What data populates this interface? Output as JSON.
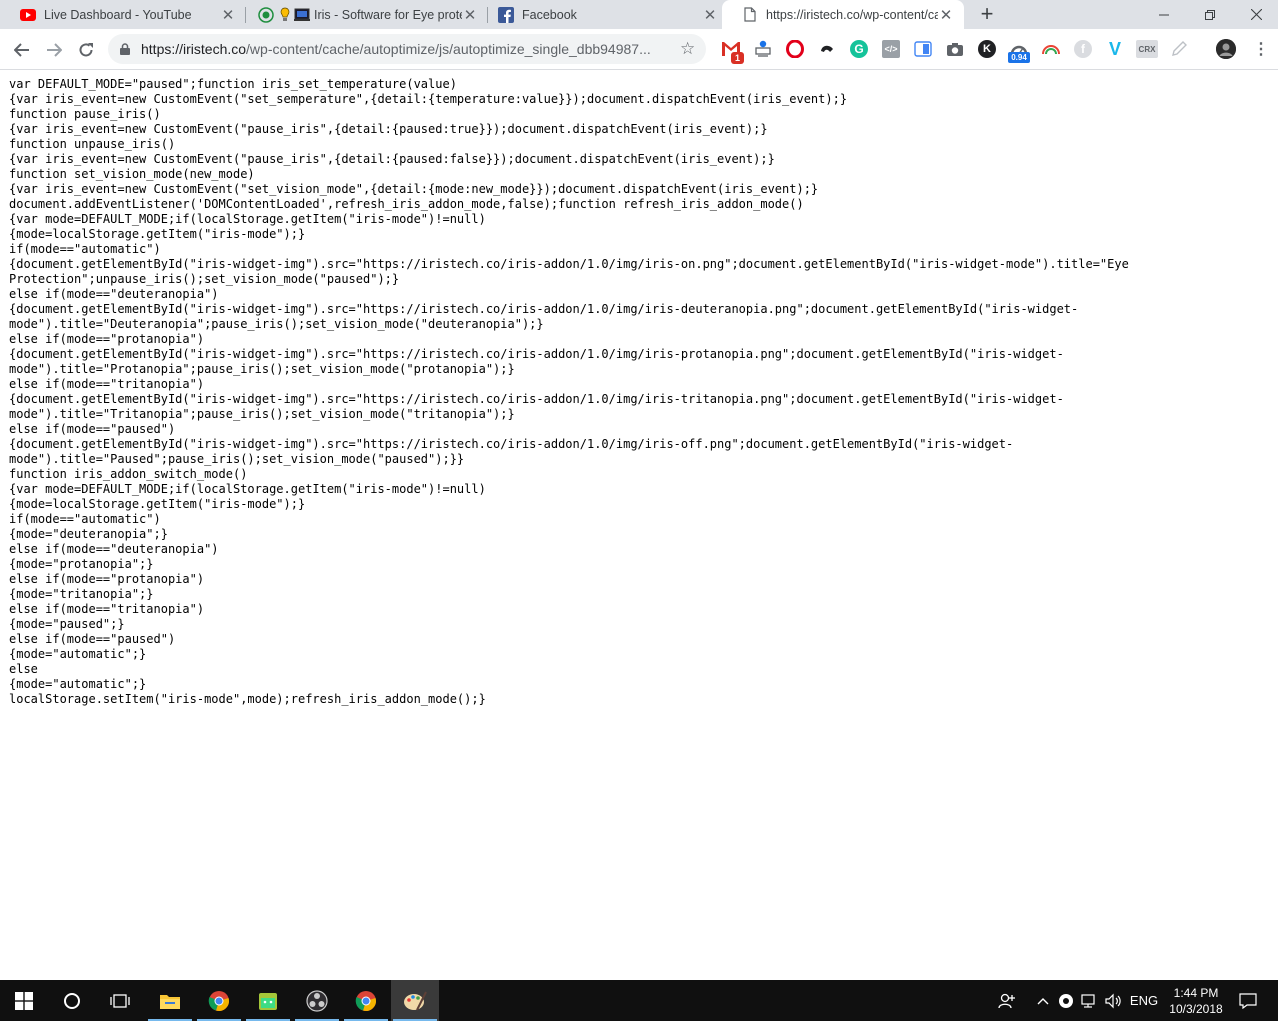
{
  "tabs": [
    {
      "title": "Live Dashboard - YouTube",
      "icon": "youtube-icon"
    },
    {
      "title": "Iris - Software for Eye prote",
      "icon": "iris-icon"
    },
    {
      "title": "Facebook",
      "icon": "facebook-icon"
    },
    {
      "title": "https://iristech.co/wp-content/ca",
      "icon": "document-icon"
    }
  ],
  "toolbar": {
    "url_host": "https://iristech.co",
    "url_path": "/wp-content/cache/autoptimize/js/autoptimize_single_dbb94987...",
    "gmail_badge": "1",
    "extension_badge": "0.94",
    "crx_label": "CRX"
  },
  "code_lines": [
    "var DEFAULT_MODE=\"paused\";function iris_set_temperature(value)",
    "{var iris_event=new CustomEvent(\"set_semperature\",{detail:{temperature:value}});document.dispatchEvent(iris_event);}",
    "function pause_iris()",
    "{var iris_event=new CustomEvent(\"pause_iris\",{detail:{paused:true}});document.dispatchEvent(iris_event);}",
    "function unpause_iris()",
    "{var iris_event=new CustomEvent(\"pause_iris\",{detail:{paused:false}});document.dispatchEvent(iris_event);}",
    "function set_vision_mode(new_mode)",
    "{var iris_event=new CustomEvent(\"set_vision_mode\",{detail:{mode:new_mode}});document.dispatchEvent(iris_event);}",
    "document.addEventListener('DOMContentLoaded',refresh_iris_addon_mode,false);function refresh_iris_addon_mode()",
    "{var mode=DEFAULT_MODE;if(localStorage.getItem(\"iris-mode\")!=null)",
    "{mode=localStorage.getItem(\"iris-mode\");}",
    "if(mode==\"automatic\")",
    "{document.getElementById(\"iris-widget-img\").src=\"https://iristech.co/iris-addon/1.0/img/iris-on.png\";document.getElementById(\"iris-widget-mode\").title=\"Eye",
    "Protection\";unpause_iris();set_vision_mode(\"paused\");}",
    "else if(mode==\"deuteranopia\")",
    "{document.getElementById(\"iris-widget-img\").src=\"https://iristech.co/iris-addon/1.0/img/iris-deuteranopia.png\";document.getElementById(\"iris-widget-",
    "mode\").title=\"Deuteranopia\";pause_iris();set_vision_mode(\"deuteranopia\");}",
    "else if(mode==\"protanopia\")",
    "{document.getElementById(\"iris-widget-img\").src=\"https://iristech.co/iris-addon/1.0/img/iris-protanopia.png\";document.getElementById(\"iris-widget-",
    "mode\").title=\"Protanopia\";pause_iris();set_vision_mode(\"protanopia\");}",
    "else if(mode==\"tritanopia\")",
    "{document.getElementById(\"iris-widget-img\").src=\"https://iristech.co/iris-addon/1.0/img/iris-tritanopia.png\";document.getElementById(\"iris-widget-",
    "mode\").title=\"Tritanopia\";pause_iris();set_vision_mode(\"tritanopia\");}",
    "else if(mode==\"paused\")",
    "{document.getElementById(\"iris-widget-img\").src=\"https://iristech.co/iris-addon/1.0/img/iris-off.png\";document.getElementById(\"iris-widget-",
    "mode\").title=\"Paused\";pause_iris();set_vision_mode(\"paused\");}}",
    "function iris_addon_switch_mode()",
    "{var mode=DEFAULT_MODE;if(localStorage.getItem(\"iris-mode\")!=null)",
    "{mode=localStorage.getItem(\"iris-mode\");}",
    "if(mode==\"automatic\")",
    "{mode=\"deuteranopia\";}",
    "else if(mode==\"deuteranopia\")",
    "{mode=\"protanopia\";}",
    "else if(mode==\"protanopia\")",
    "{mode=\"tritanopia\";}",
    "else if(mode==\"tritanopia\")",
    "{mode=\"paused\";}",
    "else if(mode==\"paused\")",
    "{mode=\"automatic\";}",
    "else",
    "{mode=\"automatic\";}",
    "localStorage.setItem(\"iris-mode\",mode);refresh_iris_addon_mode();}"
  ],
  "taskbar": {
    "language": "ENG",
    "time": "1:44 PM",
    "date": "10/3/2018"
  },
  "colors": {
    "tabstrip": "#dee1e6",
    "taskbar": "#101010",
    "accent": "#76b9ed"
  }
}
